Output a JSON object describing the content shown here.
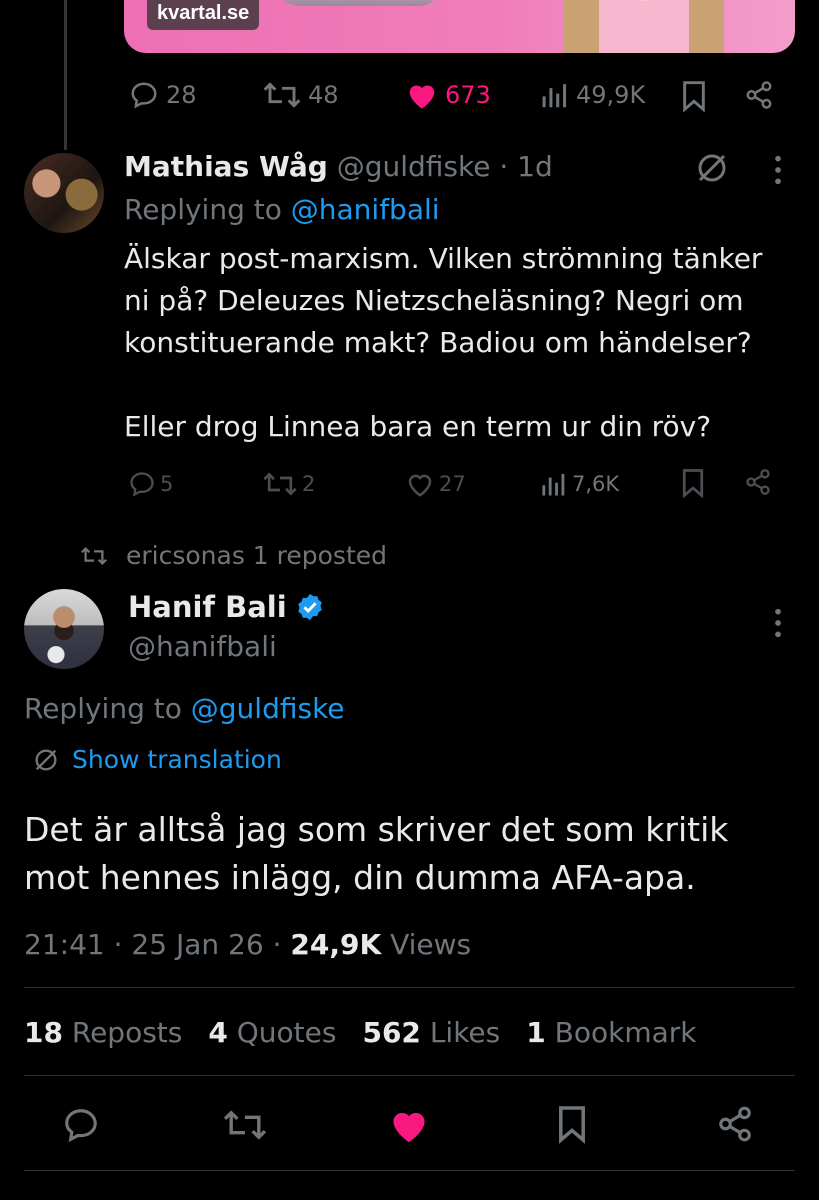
{
  "top_tweet": {
    "card_source": "kvartal.se",
    "actions": {
      "replies": "28",
      "reposts": "48",
      "likes": "673",
      "views": "49,9K"
    },
    "colors": {
      "like": "#f91880",
      "accent": "#1d9bf0"
    }
  },
  "reply_tweet": {
    "display_name": "Mathias Wåg",
    "handle": "@guldfiske",
    "time": "· 1d",
    "replying_prefix": "Replying to",
    "replying_handle": "@hanifbali",
    "body_lines": [
      "Älskar post-marxism. Vilken strömning tänker",
      "ni på? Deleuzes Nietzscheläsning? Negri om",
      "konstituerande makt? Badiou om händelser?",
      "",
      "Eller drog Linnea bara en term ur din röv?"
    ],
    "actions": {
      "replies": "5",
      "reposts": "2",
      "likes": "27",
      "views": "7,6K"
    }
  },
  "repost_note": "ericsonas 1 reposted",
  "main_tweet": {
    "display_name": "Hanif Bali",
    "handle": "@hanifbali",
    "replying_prefix": "Replying to",
    "replying_handle": "@guldfiske",
    "translate_label": "Show translation",
    "body_lines": [
      "Det är alltså jag som skriver det som kritik",
      "mot hennes inlägg, din dumma AFA-apa."
    ],
    "time": "21:41",
    "date": "25 Jan 26",
    "views_count": "24,9K",
    "views_label": "Views",
    "stats": [
      {
        "count": "18",
        "label": "Reposts"
      },
      {
        "count": "4",
        "label": "Quotes"
      },
      {
        "count": "562",
        "label": "Likes"
      },
      {
        "count": "1",
        "label": "Bookmark"
      }
    ]
  }
}
